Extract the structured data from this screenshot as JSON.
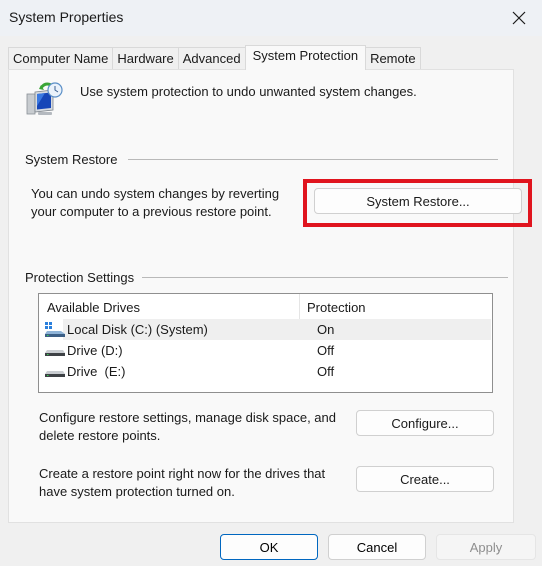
{
  "window": {
    "title": "System Properties",
    "close_icon": "close-icon"
  },
  "tabs": [
    {
      "label": "Computer Name",
      "active": false
    },
    {
      "label": "Hardware",
      "active": false
    },
    {
      "label": "Advanced",
      "active": false
    },
    {
      "label": "System Protection",
      "active": true
    },
    {
      "label": "Remote",
      "active": false
    }
  ],
  "intro": {
    "icon": "system-restore-icon",
    "text": "Use system protection to undo unwanted system changes."
  },
  "system_restore": {
    "group_label": "System Restore",
    "description_line1": "You can undo system changes by reverting",
    "description_line2": "your computer to a previous restore point.",
    "button_label": "System Restore...",
    "highlight_color": "#e0141e"
  },
  "protection_settings": {
    "group_label": "Protection Settings",
    "columns": [
      "Available Drives",
      "Protection"
    ],
    "drives": [
      {
        "name": "Local Disk (C:) (System)",
        "protection": "On",
        "icon": "system-drive-icon",
        "selected": true
      },
      {
        "name": "Drive (D:)",
        "protection": "Off",
        "icon": "drive-icon",
        "selected": false
      },
      {
        "name": "Drive  (E:)",
        "protection": "Off",
        "icon": "drive-icon",
        "selected": false
      }
    ],
    "configure_desc_line1": "Configure restore settings, manage disk space, and",
    "configure_desc_line2": "delete restore points.",
    "configure_label": "Configure...",
    "create_desc_line1": "Create a restore point right now for the drives that",
    "create_desc_line2": "have system protection turned on.",
    "create_label": "Create..."
  },
  "footer": {
    "ok_label": "OK",
    "cancel_label": "Cancel",
    "apply_label": "Apply"
  }
}
